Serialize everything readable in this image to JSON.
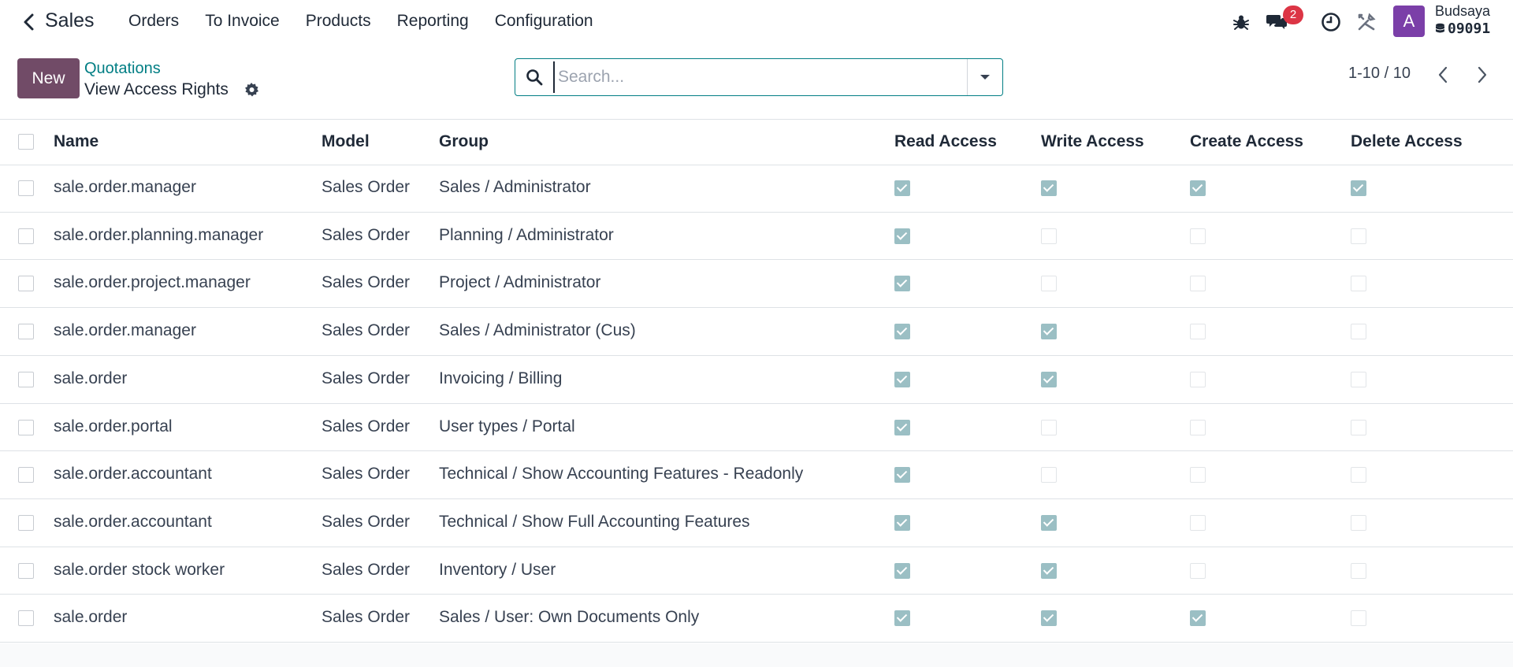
{
  "navbar": {
    "app_title": "Sales",
    "menu": [
      "Orders",
      "To Invoice",
      "Products",
      "Reporting",
      "Configuration"
    ],
    "messages_badge": "2",
    "avatar_letter": "A",
    "user_name": "Budsaya",
    "db_name": "09091",
    "avatar_color": "#7b3fa8"
  },
  "control": {
    "new_label": "New",
    "breadcrumb": "Quotations",
    "title": "View Access Rights",
    "search_placeholder": "Search...",
    "pager": "1-10 / 10",
    "accent": "#017e84",
    "brand": "#714b67"
  },
  "table": {
    "columns": [
      "Name",
      "Model",
      "Group",
      "Read Access",
      "Write Access",
      "Create Access",
      "Delete Access"
    ],
    "rows": [
      {
        "name": "sale.order.manager",
        "model": "Sales Order",
        "group": "Sales / Administrator",
        "read": true,
        "write": true,
        "create": true,
        "delete": true
      },
      {
        "name": "sale.order.planning.manager",
        "model": "Sales Order",
        "group": "Planning / Administrator",
        "read": true,
        "write": false,
        "create": false,
        "delete": false
      },
      {
        "name": "sale.order.project.manager",
        "model": "Sales Order",
        "group": "Project / Administrator",
        "read": true,
        "write": false,
        "create": false,
        "delete": false
      },
      {
        "name": "sale.order.manager",
        "model": "Sales Order",
        "group": "Sales / Administrator (Cus)",
        "read": true,
        "write": true,
        "create": false,
        "delete": false
      },
      {
        "name": "sale.order",
        "model": "Sales Order",
        "group": "Invoicing / Billing",
        "read": true,
        "write": true,
        "create": false,
        "delete": false
      },
      {
        "name": "sale.order.portal",
        "model": "Sales Order",
        "group": "User types / Portal",
        "read": true,
        "write": false,
        "create": false,
        "delete": false
      },
      {
        "name": "sale.order.accountant",
        "model": "Sales Order",
        "group": "Technical / Show Accounting Features - Readonly",
        "read": true,
        "write": false,
        "create": false,
        "delete": false
      },
      {
        "name": "sale.order.accountant",
        "model": "Sales Order",
        "group": "Technical / Show Full Accounting Features",
        "read": true,
        "write": true,
        "create": false,
        "delete": false
      },
      {
        "name": "sale.order stock worker",
        "model": "Sales Order",
        "group": "Inventory / User",
        "read": true,
        "write": true,
        "create": false,
        "delete": false
      },
      {
        "name": "sale.order",
        "model": "Sales Order",
        "group": "Sales / User: Own Documents Only",
        "read": true,
        "write": true,
        "create": true,
        "delete": false
      }
    ]
  }
}
